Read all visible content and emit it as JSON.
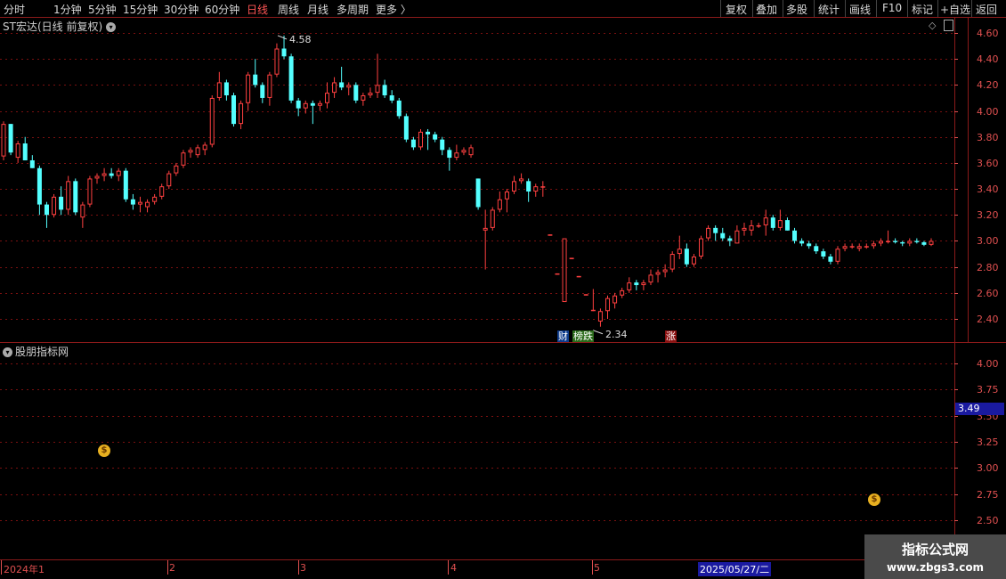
{
  "toolbar": {
    "left": [
      "分时",
      "1分钟",
      "5分钟",
      "15分钟",
      "30分钟",
      "60分钟",
      "日线",
      "周线",
      "月线",
      "多周期",
      "更多 〉"
    ],
    "active": "日线",
    "right": [
      "复权",
      "叠加",
      "多股",
      "统计",
      "画线",
      "F10",
      "标记",
      "+自选",
      "返回"
    ]
  },
  "stock": {
    "title": "ST宏达(日线 前复权)"
  },
  "indicator": {
    "title": "股朋指标网",
    "price_tag": "3.49"
  },
  "watermark": {
    "line1": "指标公式网",
    "line2": "www.zbgs3.com"
  },
  "colors": {
    "up": "#ff4040",
    "down": "#54ffff",
    "axis": "#e05050",
    "grid": "#7a1010",
    "border": "#8b1a1a"
  },
  "icons": [
    "chevron-down-icon",
    "diamond-icon",
    "settings-icon",
    "money-bag-icon"
  ],
  "chart_data": [
    {
      "type": "candlestick",
      "title": "ST宏达(日线 前复权)",
      "ylim": [
        2.3,
        4.68
      ],
      "y_ticks": [
        "4.60",
        "4.40",
        "4.20",
        "4.00",
        "3.80",
        "3.60",
        "3.40",
        "3.20",
        "3.00",
        "2.80",
        "2.60",
        "2.40"
      ],
      "annotations": {
        "high": "4.58",
        "low": "2.34"
      },
      "badges": [
        "财",
        "榜跌",
        "涨"
      ],
      "x_ticks": [
        "2024年1",
        "2",
        "3",
        "4",
        "5",
        "2025/05/27/二"
      ],
      "ohlc": [
        [
          3.65,
          3.92,
          3.62,
          3.9
        ],
        [
          3.9,
          3.9,
          3.66,
          3.68
        ],
        [
          3.64,
          3.77,
          3.6,
          3.75
        ],
        [
          3.75,
          3.8,
          3.62,
          3.62
        ],
        [
          3.62,
          3.66,
          3.56,
          3.56
        ],
        [
          3.56,
          3.58,
          3.2,
          3.28
        ],
        [
          3.28,
          3.3,
          3.1,
          3.2
        ],
        [
          3.2,
          3.36,
          3.18,
          3.34
        ],
        [
          3.34,
          3.42,
          3.2,
          3.24
        ],
        [
          3.24,
          3.5,
          3.2,
          3.46
        ],
        [
          3.46,
          3.48,
          3.2,
          3.22
        ],
        [
          3.18,
          3.3,
          3.1,
          3.28
        ],
        [
          3.28,
          3.5,
          3.26,
          3.48
        ],
        [
          3.48,
          3.52,
          3.44,
          3.5
        ],
        [
          3.5,
          3.56,
          3.46,
          3.52
        ],
        [
          3.52,
          3.56,
          3.48,
          3.5
        ],
        [
          3.5,
          3.56,
          3.46,
          3.54
        ],
        [
          3.54,
          3.56,
          3.3,
          3.32
        ],
        [
          3.32,
          3.36,
          3.24,
          3.28
        ],
        [
          3.28,
          3.34,
          3.22,
          3.3
        ],
        [
          3.26,
          3.32,
          3.22,
          3.3
        ],
        [
          3.3,
          3.36,
          3.28,
          3.34
        ],
        [
          3.34,
          3.44,
          3.32,
          3.42
        ],
        [
          3.42,
          3.54,
          3.4,
          3.52
        ],
        [
          3.52,
          3.6,
          3.5,
          3.58
        ],
        [
          3.58,
          3.7,
          3.56,
          3.68
        ],
        [
          3.68,
          3.72,
          3.64,
          3.7
        ],
        [
          3.66,
          3.74,
          3.64,
          3.72
        ],
        [
          3.7,
          3.76,
          3.66,
          3.74
        ],
        [
          3.74,
          4.12,
          3.72,
          4.1
        ],
        [
          4.1,
          4.3,
          4.08,
          4.22
        ],
        [
          4.22,
          4.24,
          4.08,
          4.12
        ],
        [
          4.12,
          4.14,
          3.88,
          3.9
        ],
        [
          3.9,
          4.08,
          3.86,
          4.06
        ],
        [
          4.06,
          4.3,
          4.0,
          4.28
        ],
        [
          4.28,
          4.4,
          4.18,
          4.2
        ],
        [
          4.2,
          4.22,
          4.06,
          4.1
        ],
        [
          4.1,
          4.3,
          4.04,
          4.28
        ],
        [
          4.28,
          4.52,
          4.26,
          4.48
        ],
        [
          4.48,
          4.58,
          4.4,
          4.42
        ],
        [
          4.42,
          4.44,
          4.06,
          4.08
        ],
        [
          4.08,
          4.1,
          3.96,
          4.02
        ],
        [
          4.02,
          4.08,
          3.98,
          4.06
        ],
        [
          4.06,
          4.08,
          3.9,
          4.04
        ],
        [
          4.04,
          4.08,
          4.0,
          4.06
        ],
        [
          4.06,
          4.22,
          4.02,
          4.14
        ],
        [
          4.14,
          4.26,
          4.1,
          4.22
        ],
        [
          4.22,
          4.34,
          4.16,
          4.18
        ],
        [
          4.18,
          4.22,
          4.12,
          4.2
        ],
        [
          4.2,
          4.22,
          4.06,
          4.08
        ],
        [
          4.08,
          4.14,
          4.04,
          4.12
        ],
        [
          4.12,
          4.18,
          4.1,
          4.14
        ],
        [
          4.14,
          4.44,
          4.1,
          4.2
        ],
        [
          4.2,
          4.24,
          4.1,
          4.12
        ],
        [
          4.12,
          4.16,
          4.06,
          4.08
        ],
        [
          4.08,
          4.1,
          3.94,
          3.96
        ],
        [
          3.96,
          3.98,
          3.76,
          3.78
        ],
        [
          3.78,
          3.8,
          3.7,
          3.72
        ],
        [
          3.72,
          3.86,
          3.7,
          3.84
        ],
        [
          3.84,
          3.86,
          3.7,
          3.82
        ],
        [
          3.82,
          3.84,
          3.76,
          3.78
        ],
        [
          3.78,
          3.8,
          3.66,
          3.7
        ],
        [
          3.7,
          3.72,
          3.54,
          3.64
        ],
        [
          3.64,
          3.74,
          3.62,
          3.68
        ],
        [
          3.68,
          3.72,
          3.66,
          3.7
        ],
        [
          3.66,
          3.74,
          3.64,
          3.72
        ],
        [
          3.48,
          3.48,
          3.24,
          3.26
        ],
        [
          3.08,
          3.24,
          2.78,
          3.1
        ],
        [
          3.1,
          3.26,
          3.08,
          3.24
        ],
        [
          3.24,
          3.38,
          3.22,
          3.32
        ],
        [
          3.32,
          3.4,
          3.22,
          3.38
        ],
        [
          3.38,
          3.5,
          3.36,
          3.46
        ],
        [
          3.46,
          3.52,
          3.44,
          3.48
        ],
        [
          3.46,
          3.48,
          3.3,
          3.38
        ],
        [
          3.38,
          3.44,
          3.34,
          3.42
        ],
        [
          3.42,
          3.46,
          3.34,
          3.42
        ],
        [
          3.05,
          3.05,
          3.04,
          3.05
        ],
        [
          2.75,
          2.75,
          2.74,
          2.75
        ],
        [
          2.53,
          3.02,
          2.53,
          3.02
        ],
        [
          2.87,
          2.87,
          2.86,
          2.87
        ],
        [
          2.73,
          2.73,
          2.72,
          2.73
        ],
        [
          2.59,
          2.59,
          2.58,
          2.59
        ],
        [
          2.47,
          2.63,
          2.46,
          2.47
        ],
        [
          2.38,
          2.48,
          2.34,
          2.46
        ],
        [
          2.46,
          2.58,
          2.4,
          2.56
        ],
        [
          2.52,
          2.6,
          2.48,
          2.58
        ],
        [
          2.58,
          2.64,
          2.56,
          2.62
        ],
        [
          2.62,
          2.72,
          2.6,
          2.68
        ],
        [
          2.68,
          2.7,
          2.62,
          2.66
        ],
        [
          2.66,
          2.7,
          2.62,
          2.68
        ],
        [
          2.68,
          2.78,
          2.66,
          2.74
        ],
        [
          2.74,
          2.78,
          2.68,
          2.76
        ],
        [
          2.76,
          2.82,
          2.72,
          2.78
        ],
        [
          2.78,
          2.92,
          2.76,
          2.9
        ],
        [
          2.9,
          3.04,
          2.86,
          2.94
        ],
        [
          2.94,
          2.98,
          2.8,
          2.82
        ],
        [
          2.82,
          2.9,
          2.8,
          2.88
        ],
        [
          2.88,
          3.04,
          2.86,
          3.02
        ],
        [
          3.02,
          3.12,
          3.0,
          3.1
        ],
        [
          3.1,
          3.12,
          3.0,
          3.06
        ],
        [
          3.06,
          3.1,
          3.0,
          3.02
        ],
        [
          3.02,
          3.04,
          2.96,
          3.0
        ],
        [
          2.98,
          3.12,
          2.98,
          3.08
        ],
        [
          3.08,
          3.14,
          3.04,
          3.1
        ],
        [
          3.08,
          3.16,
          3.04,
          3.12
        ],
        [
          3.12,
          3.14,
          3.1,
          3.12
        ],
        [
          3.12,
          3.24,
          3.04,
          3.18
        ],
        [
          3.18,
          3.2,
          3.08,
          3.1
        ],
        [
          3.1,
          3.24,
          3.08,
          3.16
        ],
        [
          3.16,
          3.18,
          3.08,
          3.08
        ],
        [
          3.08,
          3.1,
          2.98,
          3.0
        ],
        [
          3.0,
          3.02,
          2.96,
          2.98
        ],
        [
          2.98,
          3.0,
          2.94,
          2.96
        ],
        [
          2.96,
          2.98,
          2.9,
          2.92
        ],
        [
          2.92,
          2.94,
          2.86,
          2.88
        ],
        [
          2.88,
          2.9,
          2.82,
          2.84
        ],
        [
          2.84,
          2.96,
          2.82,
          2.94
        ],
        [
          2.94,
          2.98,
          2.92,
          2.96
        ],
        [
          2.96,
          2.98,
          2.94,
          2.96
        ],
        [
          2.94,
          2.98,
          2.92,
          2.96
        ],
        [
          2.96,
          2.98,
          2.94,
          2.96
        ],
        [
          2.96,
          3.0,
          2.94,
          2.98
        ],
        [
          2.98,
          3.02,
          2.96,
          3.0
        ],
        [
          3.0,
          3.08,
          2.98,
          3.0
        ],
        [
          3.0,
          3.02,
          2.98,
          2.99
        ],
        [
          2.99,
          3.0,
          2.96,
          2.98
        ],
        [
          2.98,
          3.02,
          2.96,
          3.0
        ],
        [
          3.0,
          3.02,
          2.98,
          2.99
        ],
        [
          2.99,
          3.0,
          2.96,
          2.97
        ],
        [
          2.97,
          3.02,
          2.96,
          3.0
        ]
      ]
    },
    {
      "type": "line",
      "title": "股朋指标网",
      "ylim": [
        2.4,
        4.15
      ],
      "y_ticks": [
        "4.00",
        "3.75",
        "3.50",
        "3.25",
        "3.00",
        "2.75",
        "2.50"
      ],
      "current_value": 3.49,
      "markers": [
        "money-bag",
        "money-bag"
      ]
    }
  ]
}
